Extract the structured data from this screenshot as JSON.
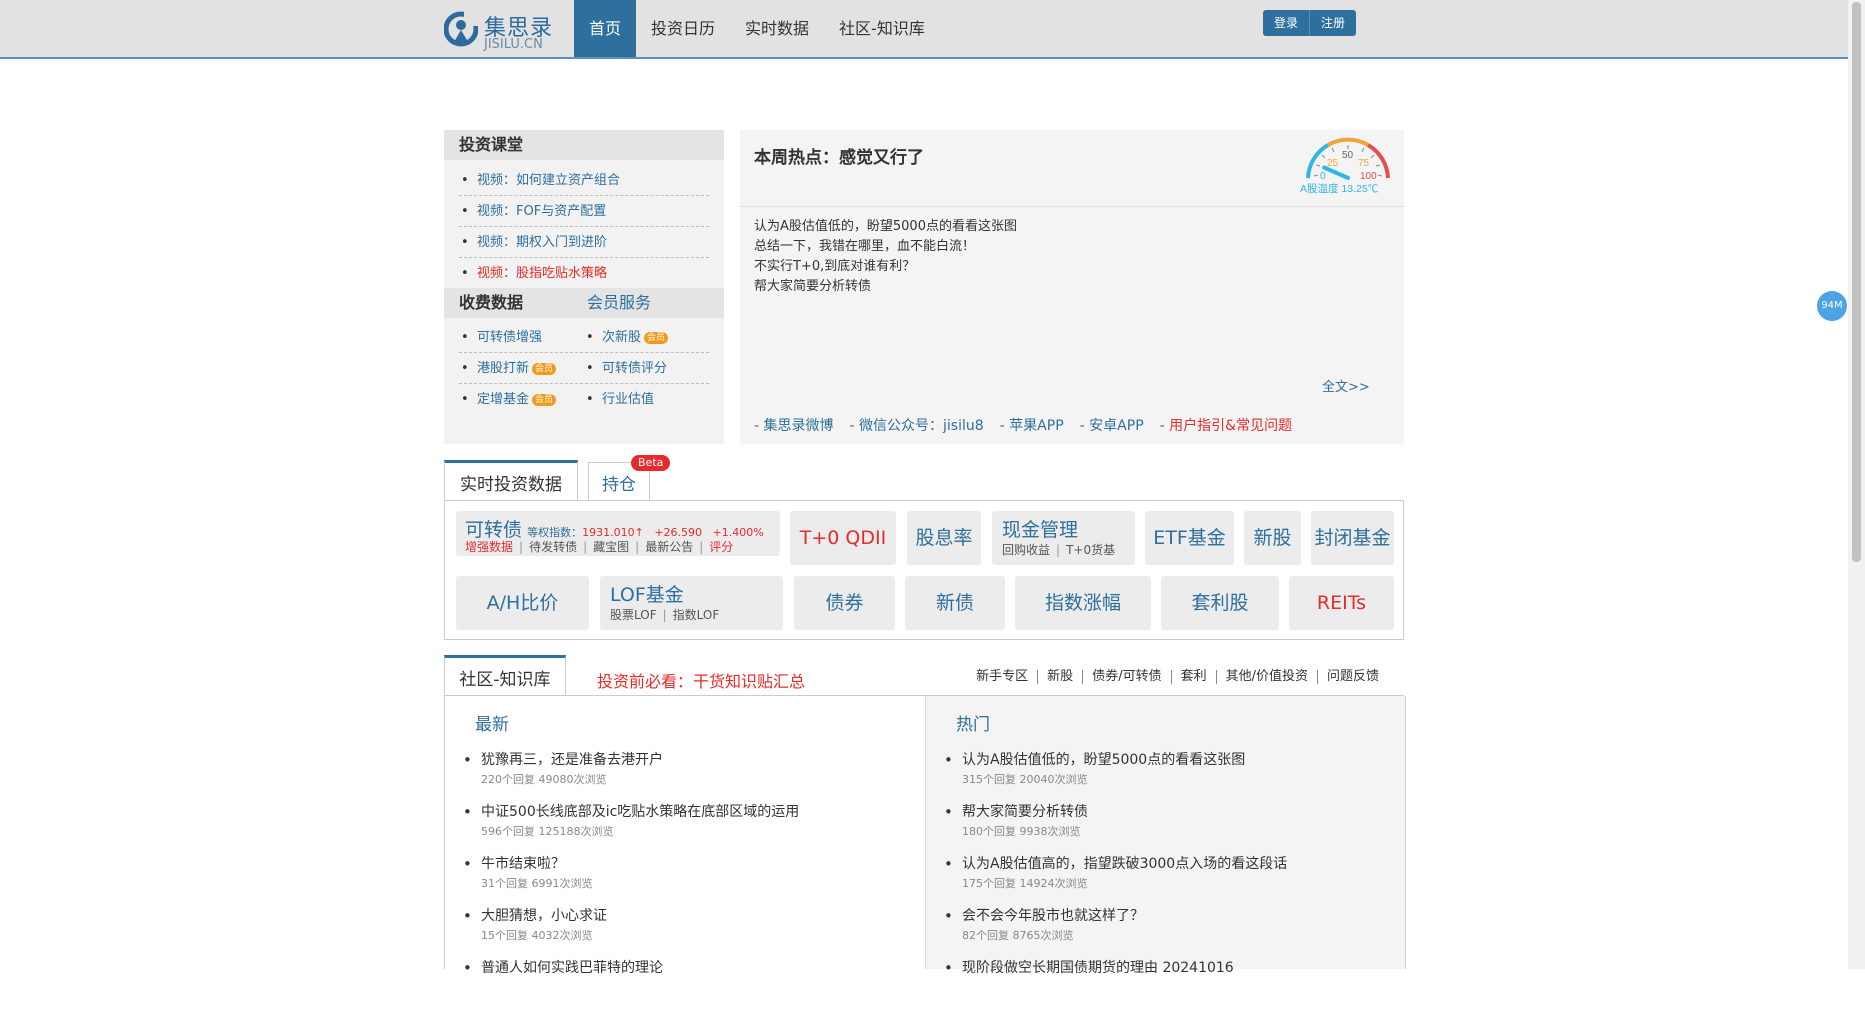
{
  "header": {
    "logo": {
      "name": "集思录",
      "sub": "JISILU.CN"
    },
    "nav": [
      "首页",
      "投资日历",
      "实时数据",
      "社区-知识库"
    ],
    "auth": {
      "login": "登录",
      "register": "注册"
    }
  },
  "float_badge": "94M",
  "courses": {
    "title": "投资课堂",
    "items": [
      "视频：如何建立资产组合",
      "视频：FOF与资产配置",
      "视频：期权入门到进阶",
      "视频：股指吃贴水策略"
    ]
  },
  "paid": {
    "title": "收费数据",
    "member": "会员服务",
    "vip_label": "会员",
    "rows": [
      [
        "可转债增强",
        "次新股"
      ],
      [
        "港股打新",
        "可转债评分"
      ],
      [
        "定增基金",
        "行业估值"
      ]
    ]
  },
  "hot": {
    "title": "本周热点：感觉又行了",
    "lines": [
      "认为A股估值低的，盼望5000点的看看这张图",
      "总结一下，我错在哪里，血不能白流！",
      "不实行T+0,到底对谁有利？",
      "帮大家简要分析转债"
    ],
    "fulltext": "全文>>",
    "gauge": {
      "t0": "0",
      "t25": "25",
      "t50": "50",
      "t75": "75",
      "t100": "100",
      "label": "A股温度 13.25℃",
      "value": 13.25
    },
    "links": [
      "集思录微博",
      "微信公众号：jisilu8",
      "苹果APP",
      "安卓APP",
      "用户指引&常见问题"
    ]
  },
  "realtime": {
    "tab1": "实时投资数据",
    "tab2": "持仓",
    "beta": "Beta",
    "kzz": {
      "title": "可转债",
      "idx_label": "等权指数：",
      "idx_value": "1931.010↑",
      "change": "+26.590",
      "pct": "+1.400%",
      "links": [
        "增强数据",
        "待发转债",
        "藏宝图",
        "最新公告",
        "评分"
      ]
    },
    "tiles_row1": [
      "T+0 QDII",
      "股息率"
    ],
    "cash": {
      "title": "现金管理",
      "subs": [
        "回购收益",
        "T+0货基"
      ]
    },
    "tiles_row1b": [
      "ETF基金",
      "新股",
      "封闭基金"
    ],
    "ah": "A/H比价",
    "lof": {
      "title": "LOF基金",
      "subs": [
        "股票LOF",
        "指数LOF"
      ]
    },
    "tiles_row2": [
      "债券",
      "新债",
      "指数涨幅",
      "套利股",
      "REITs"
    ]
  },
  "community": {
    "tab": "社区-知识库",
    "must_read": "投资前必看：干货知识贴汇总",
    "cats": [
      "新手专区",
      "新股",
      "债券/可转债",
      "套利",
      "其他/价值投资",
      "问题反馈"
    ],
    "latest_title": "最新",
    "hot_title": "热门",
    "latest": [
      {
        "title": "犹豫再三，还是准备去港开户",
        "meta": "220个回复 49080次浏览"
      },
      {
        "title": "中证500长线底部及ic吃贴水策略在底部区域的运用",
        "meta": "596个回复 125188次浏览"
      },
      {
        "title": "牛市结束啦？",
        "meta": "31个回复 6991次浏览"
      },
      {
        "title": "大胆猜想，小心求证",
        "meta": "15个回复 4032次浏览"
      },
      {
        "title": "普通人如何实践巴菲特的理论",
        "meta": ""
      }
    ],
    "hot": [
      {
        "title": "认为A股估值低的，盼望5000点的看看这张图",
        "meta": "315个回复 20040次浏览"
      },
      {
        "title": "帮大家简要分析转债",
        "meta": "180个回复 9938次浏览"
      },
      {
        "title": "认为A股估值高的，指望跌破3000点入场的看这段话",
        "meta": "175个回复 14924次浏览"
      },
      {
        "title": "会不会今年股市也就这样了？",
        "meta": "82个回复 8765次浏览"
      },
      {
        "title": "现阶段做空长期国债期货的理由 20241016",
        "meta": ""
      }
    ]
  }
}
